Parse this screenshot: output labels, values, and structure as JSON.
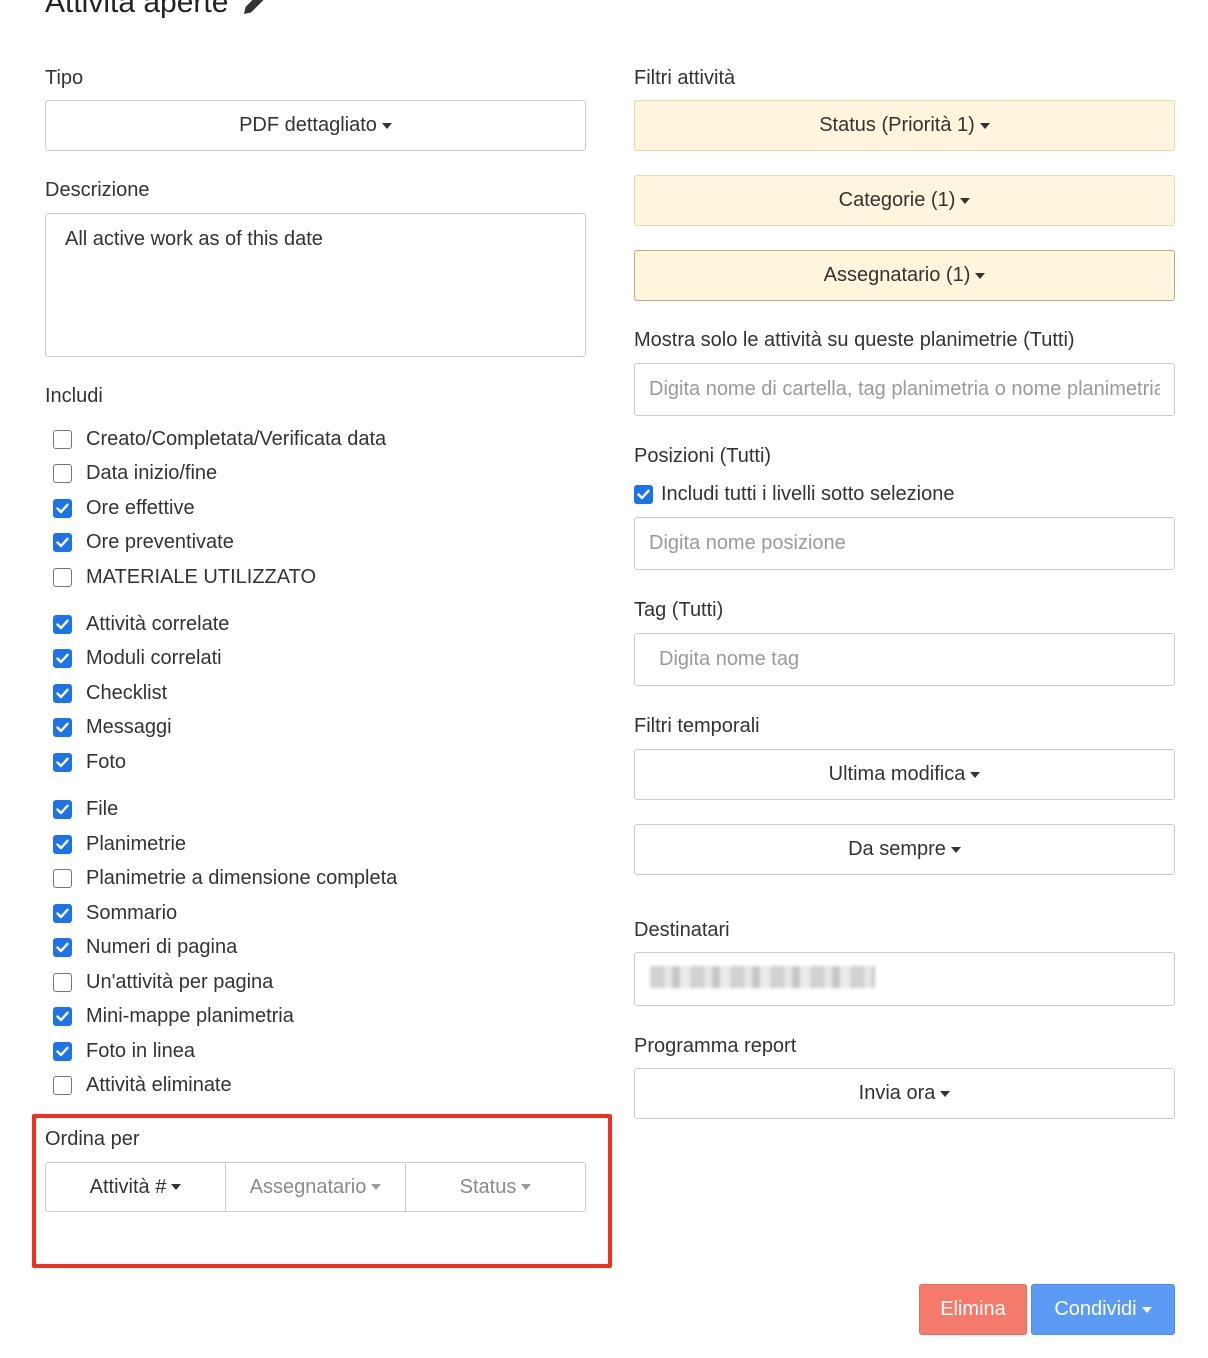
{
  "page": {
    "title": "Attività aperte"
  },
  "left": {
    "type_label": "Tipo",
    "type_value": "PDF dettagliato",
    "description_label": "Descrizione",
    "description_value": "All active work as of this date",
    "include_label": "Includi",
    "include_items": [
      {
        "label": "Creato/Completata/Verificata data",
        "checked": false
      },
      {
        "label": "Data inizio/fine",
        "checked": false
      },
      {
        "label": "Ore effettive",
        "checked": true
      },
      {
        "label": "Ore preventivate",
        "checked": true
      },
      {
        "label": "MATERIALE UTILIZZATO",
        "checked": false
      },
      {
        "label": "Attività correlate",
        "checked": true
      },
      {
        "label": "Moduli correlati",
        "checked": true
      },
      {
        "label": "Checklist",
        "checked": true
      },
      {
        "label": "Messaggi",
        "checked": true
      },
      {
        "label": "Foto",
        "checked": true
      },
      {
        "label": "File",
        "checked": true
      },
      {
        "label": "Planimetrie",
        "checked": true
      },
      {
        "label": "Planimetrie a dimensione completa",
        "checked": false
      },
      {
        "label": "Sommario",
        "checked": true
      },
      {
        "label": "Numeri di pagina",
        "checked": true
      },
      {
        "label": "Un'attività per pagina",
        "checked": false
      },
      {
        "label": "Mini-mappe planimetria",
        "checked": true
      },
      {
        "label": "Foto in linea",
        "checked": true
      },
      {
        "label": "Attività eliminate",
        "checked": false
      }
    ],
    "sort_label": "Ordina per",
    "sort_options": [
      "Attività #",
      "Assegnatario",
      "Status"
    ]
  },
  "right": {
    "filters_label": "Filtri attività",
    "filter_status": "Status (Priorità 1)",
    "filter_categories": "Categorie (1)",
    "filter_assignee": "Assegnatario (1)",
    "plans_label": "Mostra solo le attività su queste planimetrie (Tutti)",
    "plans_placeholder": "Digita nome di cartella, tag planimetria o nome planimetria",
    "positions_label": "Posizioni (Tutti)",
    "positions_include_all": "Includi tutti i livelli sotto selezione",
    "positions_include_checked": true,
    "positions_placeholder": "Digita nome posizione",
    "tags_label": "Tag (Tutti)",
    "tags_placeholder": "Digita nome tag",
    "time_filters_label": "Filtri temporali",
    "time_field": "Ultima modifica",
    "time_range": "Da sempre",
    "recipients_label": "Destinatari",
    "schedule_label": "Programma report",
    "schedule_value": "Invia ora"
  },
  "actions": {
    "delete": "Elimina",
    "share": "Condividi"
  },
  "colors": {
    "filter_active_bg": "#fdf5dc",
    "checkbox_on": "#1e73e8",
    "delete_bg": "#f47a6b",
    "share_bg": "#5b9bf6",
    "highlight_border": "#f0301f"
  }
}
